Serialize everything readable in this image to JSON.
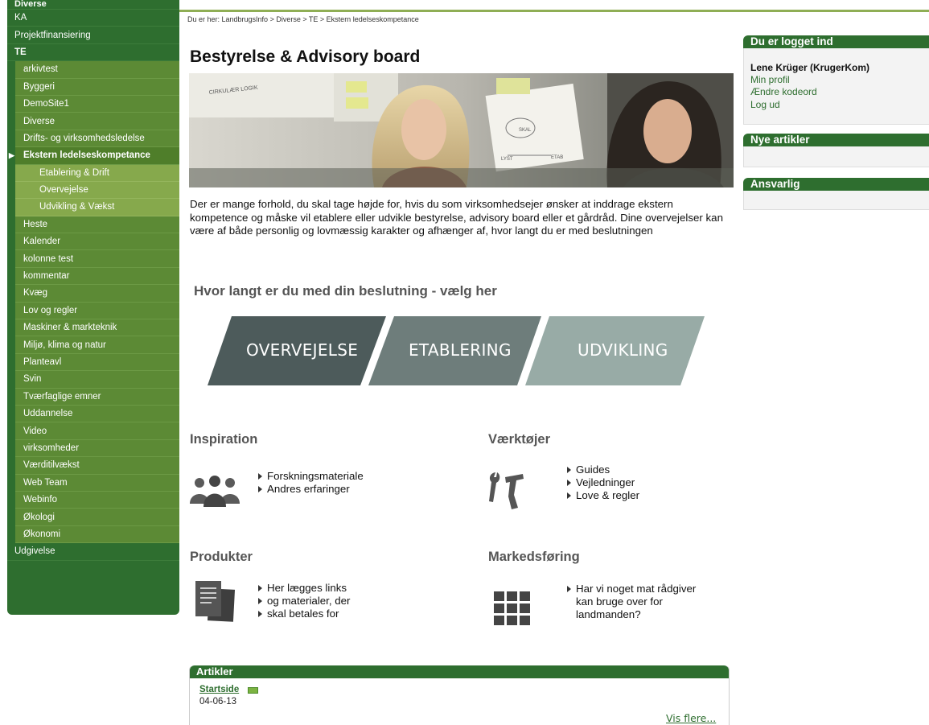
{
  "sidebar": {
    "items": [
      {
        "label": "Diverse",
        "level": 1,
        "bold": true,
        "cut": true
      },
      {
        "label": "KA",
        "level": 1
      },
      {
        "label": "Projektfinansiering",
        "level": 1
      },
      {
        "label": "TE",
        "level": 1,
        "bold": true
      },
      {
        "label": "arkivtest",
        "level": 2
      },
      {
        "label": "Byggeri",
        "level": 2
      },
      {
        "label": "DemoSite1",
        "level": 2
      },
      {
        "label": "Diverse",
        "level": 2
      },
      {
        "label": "Drifts- og virksomhedsledelse",
        "level": 2
      },
      {
        "label": "Ekstern ledelseskompetance",
        "level": 2,
        "current": true
      },
      {
        "label": "Etablering & Drift",
        "level": 3
      },
      {
        "label": "Overvejelse",
        "level": 3
      },
      {
        "label": "Udvikling & Vækst",
        "level": 3
      },
      {
        "label": "Heste",
        "level": 2
      },
      {
        "label": "Kalender",
        "level": 2
      },
      {
        "label": "kolonne test",
        "level": 2
      },
      {
        "label": "kommentar",
        "level": 2
      },
      {
        "label": "Kvæg",
        "level": 2
      },
      {
        "label": "Lov og regler",
        "level": 2
      },
      {
        "label": "Maskiner & markteknik",
        "level": 2
      },
      {
        "label": "Miljø, klima og natur",
        "level": 2
      },
      {
        "label": "Planteavl",
        "level": 2
      },
      {
        "label": "Svin",
        "level": 2
      },
      {
        "label": "Tværfaglige emner",
        "level": 2
      },
      {
        "label": "Uddannelse",
        "level": 2
      },
      {
        "label": "Video",
        "level": 2
      },
      {
        "label": "virksomheder",
        "level": 2
      },
      {
        "label": "Værditilvækst",
        "level": 2
      },
      {
        "label": "Web Team",
        "level": 2
      },
      {
        "label": "Webinfo",
        "level": 2
      },
      {
        "label": "Økologi",
        "level": 2
      },
      {
        "label": "Økonomi",
        "level": 2
      },
      {
        "label": "Udgivelse",
        "level": 1
      }
    ]
  },
  "breadcrumb": "Du er her: LandbrugsInfo > Diverse > TE > Ekstern ledelseskompetance",
  "main": {
    "title": "Bestyrelse & Advisory board",
    "intro": "Der er mange forhold, du skal tage højde for, hvis du som virksomhedsejer ønsker at inddrage ekstern kompetence og måske vil etablere eller udvikle bestyrelse, advisory board eller et gårdråd. Dine overvejelser kan være af både personlig og lovmæssig karakter og afhænger af, hvor langt du er med beslutningen",
    "hero_whiteboard_text": [
      "CIRKULÆR LOGIK",
      "SKAL",
      "LYST",
      "ETAB"
    ],
    "choose_heading": "Hvor langt er du med din beslutning - vælg her",
    "steps": [
      {
        "label": "OVERVEJELSE",
        "color": "#4d5b5b"
      },
      {
        "label": "ETABLERING",
        "color": "#6e7d7b"
      },
      {
        "label": "UDVIKLING",
        "color": "#98aba6"
      }
    ],
    "sections": {
      "inspiration": {
        "title": "Inspiration",
        "icon": "people-icon",
        "links": [
          "Forskningsmateriale",
          "Andres erfaringer"
        ]
      },
      "vaerktoejer": {
        "title": "Værktøjer",
        "icon": "tools-icon",
        "links": [
          "Guides",
          "Vejledninger",
          "Love & regler"
        ]
      },
      "produkter": {
        "title": "Produkter",
        "icon": "documents-icon",
        "links": [
          "Her lægges links",
          "og materialer, der",
          "skal betales for"
        ]
      },
      "markedsfoering": {
        "title": "Markedsføring",
        "icon": "grid-icon",
        "links": [
          "Har vi noget mat rådgiver",
          "kan bruge over for",
          "landmanden?"
        ]
      }
    },
    "articles": {
      "header": "Artikler",
      "items": [
        {
          "title": "Startside",
          "date": "04-06-13"
        }
      ],
      "more": "Vis flere..."
    }
  },
  "right": {
    "login": {
      "header": "Du er logget ind",
      "user": "Lene Krüger (KrugerKom)",
      "links": [
        "Min profil",
        "Ændre kodeord",
        "Log ud"
      ]
    },
    "new_articles_header": "Nye artikler",
    "responsible_header": "Ansvarlig"
  },
  "colors": {
    "brand_green": "#2e6e2f",
    "menu_green": "#5c8a35",
    "submenu_green": "#86a94c"
  }
}
